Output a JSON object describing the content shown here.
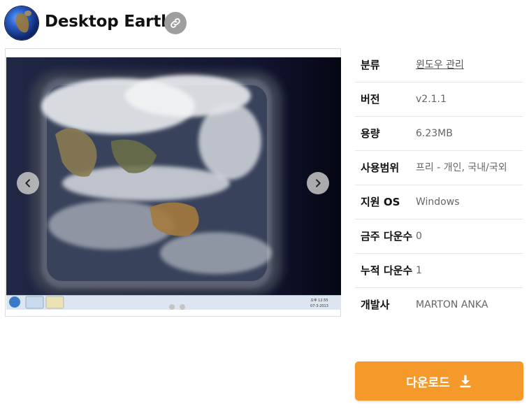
{
  "header": {
    "title": "Desktop Earth",
    "logo_icon": "earth-globe-icon",
    "link_icon": "link-icon"
  },
  "viewer": {
    "prev_icon": "chevron-left-icon",
    "next_icon": "chevron-right-icon",
    "slide_count": 2,
    "active_slide": 0,
    "taskbar": {
      "clock_time": "오후 12:55",
      "clock_date": "07-3-2013"
    }
  },
  "info": {
    "rows": [
      {
        "label": "분류",
        "value": "윈도우 관리",
        "is_link": true
      },
      {
        "label": "버전",
        "value": "v2.1.1"
      },
      {
        "label": "용량",
        "value": "6.23MB"
      },
      {
        "label": "사용범위",
        "value": "프리 - 개인, 국내/국외"
      },
      {
        "label": "지원 OS",
        "value": "Windows"
      },
      {
        "label": "금주 다운수",
        "value": "0"
      },
      {
        "label": "누적 다운수",
        "value": "1"
      },
      {
        "label": "개발사",
        "value": "MARTON ANKA"
      }
    ]
  },
  "download": {
    "label": "다운로드",
    "icon": "download-icon"
  },
  "colors": {
    "accent": "#f59a2a",
    "link_button": "#9e9e9e",
    "divider": "#e6e6e6"
  }
}
